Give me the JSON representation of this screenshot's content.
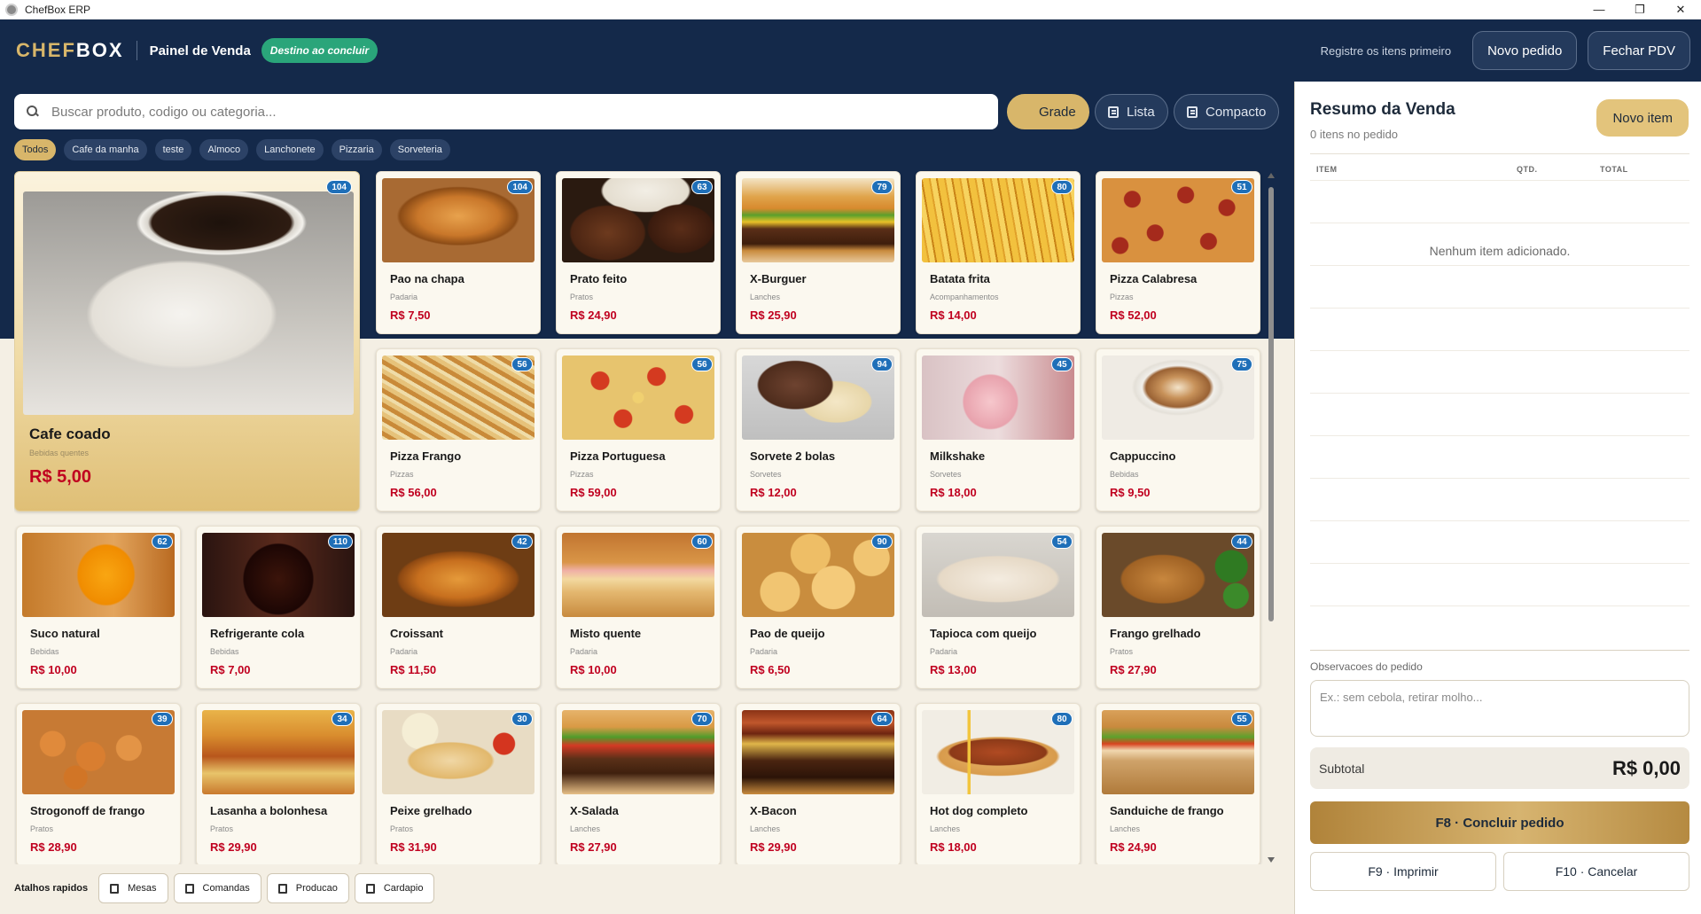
{
  "window": {
    "title": "ChefBox ERP"
  },
  "header": {
    "logo_chef": "CHEF",
    "logo_box": "BOX",
    "title": "Painel de Venda",
    "badge": "Destino ao concluir",
    "hint": "Registre os itens primeiro",
    "new_order": "Novo pedido",
    "close_pdv": "Fechar PDV"
  },
  "search": {
    "placeholder": "Buscar produto, codigo ou categoria..."
  },
  "views": {
    "grid": "Grade",
    "list": "Lista",
    "compact": "Compacto",
    "active": "Grade"
  },
  "categories": [
    "Todos",
    "Cafe da manha",
    "teste",
    "Almoco",
    "Lanchonete",
    "Pizzaria",
    "Sorveteria"
  ],
  "products": [
    {
      "name": "Cafe coado",
      "category": "Bebidas quentes",
      "price": "R$ 5,00",
      "stock": "104",
      "icon": "coffee-image",
      "featured": true
    },
    {
      "name": "Pao na chapa",
      "category": "Padaria",
      "price": "R$ 7,50",
      "stock": "104",
      "icon": "toast-image"
    },
    {
      "name": "Prato feito",
      "category": "Pratos",
      "price": "R$ 24,90",
      "stock": "63",
      "icon": "plate-image"
    },
    {
      "name": "X-Burguer",
      "category": "Lanches",
      "price": "R$ 25,90",
      "stock": "79",
      "icon": "burger-image"
    },
    {
      "name": "Batata frita",
      "category": "Acompanhamentos",
      "price": "R$ 14,00",
      "stock": "80",
      "icon": "fries-image"
    },
    {
      "name": "Pizza Calabresa",
      "category": "Pizzas",
      "price": "R$ 52,00",
      "stock": "51",
      "icon": "pizza-image"
    },
    {
      "name": "Pizza Frango",
      "category": "Pizzas",
      "price": "R$ 56,00",
      "stock": "56",
      "icon": "pizza-image"
    },
    {
      "name": "Pizza Portuguesa",
      "category": "Pizzas",
      "price": "R$ 59,00",
      "stock": "56",
      "icon": "pizza-image"
    },
    {
      "name": "Sorvete 2 bolas",
      "category": "Sorvetes",
      "price": "R$ 12,00",
      "stock": "94",
      "icon": "ice-cream-image"
    },
    {
      "name": "Milkshake",
      "category": "Sorvetes",
      "price": "R$ 18,00",
      "stock": "45",
      "icon": "milkshake-image"
    },
    {
      "name": "Cappuccino",
      "category": "Bebidas",
      "price": "R$ 9,50",
      "stock": "75",
      "icon": "cappuccino-image"
    },
    {
      "name": "Suco natural",
      "category": "Bebidas",
      "price": "R$ 10,00",
      "stock": "62",
      "icon": "juice-image"
    },
    {
      "name": "Refrigerante cola",
      "category": "Bebidas",
      "price": "R$ 7,00",
      "stock": "110",
      "icon": "soda-image"
    },
    {
      "name": "Croissant",
      "category": "Padaria",
      "price": "R$ 11,50",
      "stock": "42",
      "icon": "croissant-image"
    },
    {
      "name": "Misto quente",
      "category": "Padaria",
      "price": "R$ 10,00",
      "stock": "60",
      "icon": "sandwich-image"
    },
    {
      "name": "Pao de queijo",
      "category": "Padaria",
      "price": "R$ 6,50",
      "stock": "90",
      "icon": "cheese-bread-image"
    },
    {
      "name": "Tapioca com queijo",
      "category": "Padaria",
      "price": "R$ 13,00",
      "stock": "54",
      "icon": "tapioca-image"
    },
    {
      "name": "Frango grelhado",
      "category": "Pratos",
      "price": "R$ 27,90",
      "stock": "44",
      "icon": "chicken-image"
    },
    {
      "name": "Strogonoff de frango",
      "category": "Pratos",
      "price": "R$ 28,90",
      "stock": "39",
      "icon": "stroganoff-image"
    },
    {
      "name": "Lasanha a bolonhesa",
      "category": "Pratos",
      "price": "R$ 29,90",
      "stock": "34",
      "icon": "lasagna-image"
    },
    {
      "name": "Peixe grelhado",
      "category": "Pratos",
      "price": "R$ 31,90",
      "stock": "30",
      "icon": "fish-image"
    },
    {
      "name": "X-Salada",
      "category": "Lanches",
      "price": "R$ 27,90",
      "stock": "70",
      "icon": "burger-image"
    },
    {
      "name": "X-Bacon",
      "category": "Lanches",
      "price": "R$ 29,90",
      "stock": "64",
      "icon": "burger-image"
    },
    {
      "name": "Hot dog completo",
      "category": "Lanches",
      "price": "R$ 18,00",
      "stock": "80",
      "icon": "hotdog-image"
    },
    {
      "name": "Sanduiche de frango",
      "category": "Lanches",
      "price": "R$ 24,90",
      "stock": "55",
      "icon": "sandwich-image"
    }
  ],
  "shortcuts": {
    "label": "Atalhos rapidos",
    "items": [
      "Mesas",
      "Comandas",
      "Producao",
      "Cardapio"
    ]
  },
  "summary": {
    "title": "Resumo da Venda",
    "count_text": "0 itens no pedido",
    "new_item": "Novo item",
    "col_item": "ITEM",
    "col_qty": "QTD.",
    "col_total": "TOTAL",
    "empty": "Nenhum item adicionado.",
    "obs_label": "Observacoes do pedido",
    "obs_placeholder": "Ex.: sem cebola, retirar molho...",
    "subtotal_label": "Subtotal",
    "subtotal_value": "R$ 0,00",
    "conclude": "F8 · Concluir pedido",
    "print": "F9 · Imprimir",
    "cancel": "F10 · Cancelar"
  },
  "colors": {
    "navy": "#14294a",
    "gold": "#d8b66a",
    "price_red": "#c0001f",
    "stock_blue": "#1f6fb8",
    "badge_green": "#2aa57a"
  }
}
